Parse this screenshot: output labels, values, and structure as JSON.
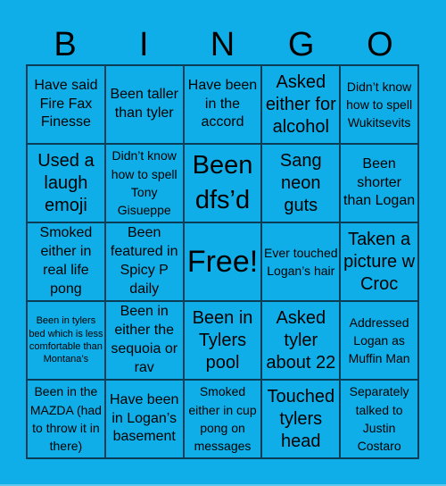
{
  "header": {
    "letters": [
      "B",
      "I",
      "N",
      "G",
      "O"
    ]
  },
  "board": {
    "rows": [
      [
        "Have said Fire Fax Finesse",
        "Been taller than tyler",
        "Have been in the accord",
        "Asked either for alcohol",
        "Didn’t know how to spell Wukitsevits"
      ],
      [
        "Used a laugh emoji",
        "Didn’t know how to spell Tony Gisueppe",
        "Been dfs’d",
        "Sang neon guts",
        "Been shorter than Logan"
      ],
      [
        "Smoked either in real life pong",
        "Been featured in Spicy P daily",
        "Free!",
        "Ever touched Logan’s hair",
        "Taken a picture w Croc"
      ],
      [
        "Been in tylers bed which is less comfortable than Montana’s",
        "Been in either the sequoia or rav",
        "Been in Tylers pool",
        "Asked tyler about 22",
        "Addressed Logan as Muffin Man"
      ],
      [
        "Been in the MAZDA (had to throw it in there)",
        "Have been in Logan’s basement",
        "Smoked either in cup pong on messages",
        "Touched tylers head",
        "Separately talked to Justin Costaro"
      ]
    ]
  },
  "colors": {
    "background": "#10aee8",
    "grid_line": "#0b3e56",
    "text": "#000000"
  }
}
